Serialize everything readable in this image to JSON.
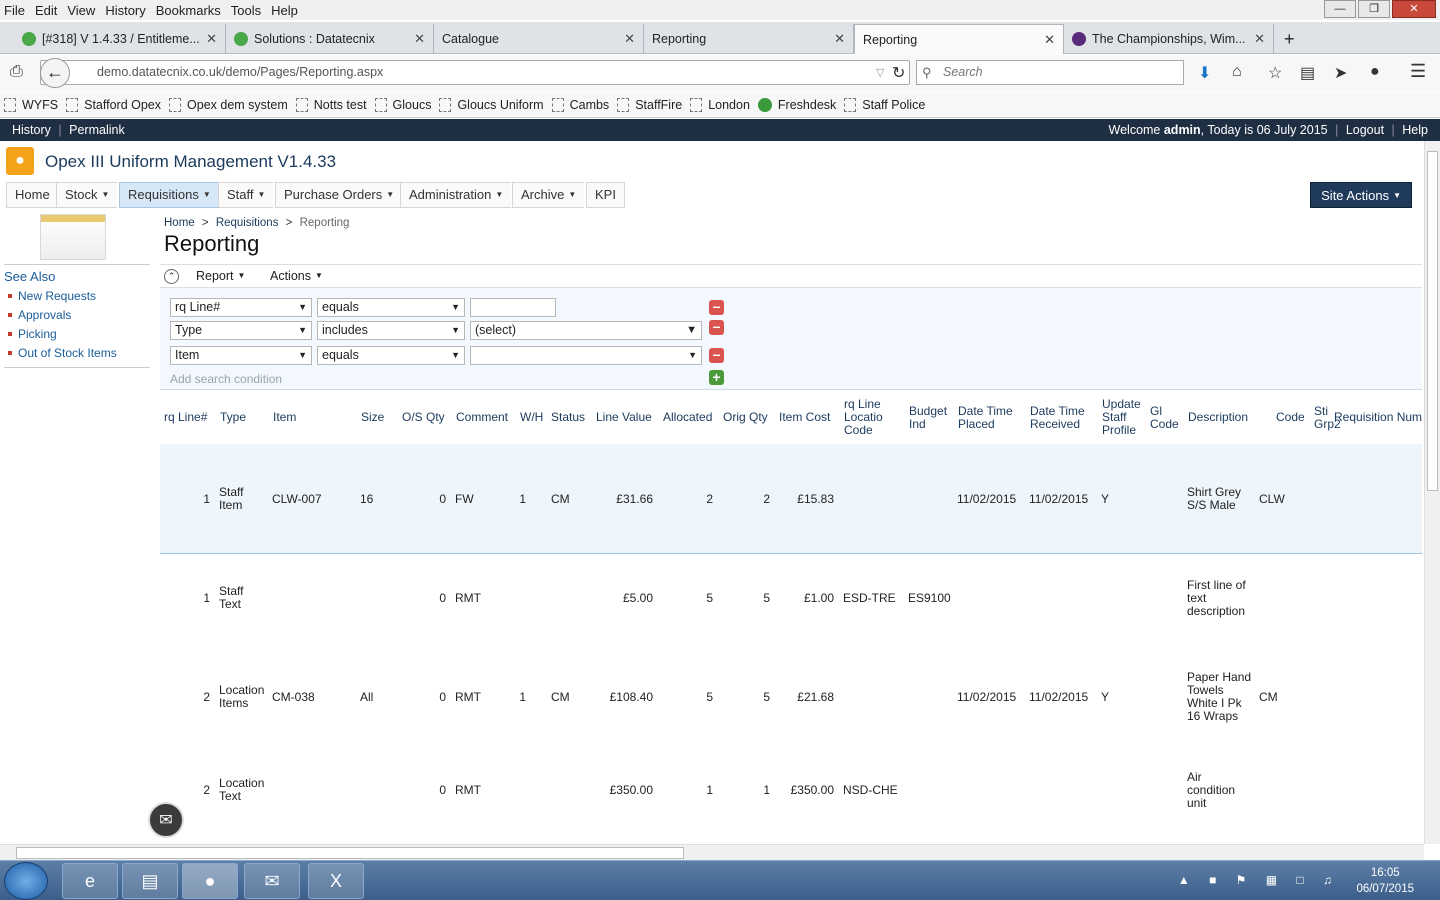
{
  "menubar": [
    "File",
    "Edit",
    "View",
    "History",
    "Bookmarks",
    "Tools",
    "Help"
  ],
  "tabs": [
    {
      "label": "[#318] V 1.4.33 / Entitleme...",
      "icon": "green"
    },
    {
      "label": "Solutions : Datatecnix",
      "icon": "green"
    },
    {
      "label": "Catalogue",
      "icon": ""
    },
    {
      "label": "Reporting",
      "icon": ""
    },
    {
      "label": "Reporting",
      "icon": ""
    },
    {
      "label": "The Championships, Wim...",
      "icon": "purple"
    }
  ],
  "nav": {
    "url": "demo.datatecnix.co.uk/demo/Pages/Reporting.aspx",
    "search_placeholder": "Search"
  },
  "bookmarks": [
    "WYFS",
    "Stafford Opex",
    "Opex dem system",
    "Notts test",
    "Gloucs",
    "Gloucs Uniform",
    "Cambs",
    "StaffFire",
    "London",
    "Freshdesk",
    "Staff Police"
  ],
  "sitetop": {
    "history": "History",
    "sep": "|",
    "permalink": "Permalink",
    "welcome_pre": "Welcome ",
    "user": "admin",
    "welcome_post": ", Today is 06 July 2015",
    "logout": "Logout",
    "help": "Help"
  },
  "app": {
    "title": "Opex III Uniform Management V1.4.33"
  },
  "topnav": [
    "Home",
    "Stock",
    "Requisitions",
    "Staff",
    "Purchase Orders",
    "Administration",
    "Archive",
    "KPI"
  ],
  "site_actions": "Site Actions",
  "sidebar": {
    "title": "See Also",
    "items": [
      "New Requests",
      "Approvals",
      "Picking",
      "Out of Stock Items"
    ]
  },
  "breadcrumb": {
    "home": "Home",
    "sep": ">",
    "requisitions": "Requisitions",
    "current": "Reporting"
  },
  "page_title": "Reporting",
  "toolbar": {
    "report": "Report",
    "actions": "Actions"
  },
  "filters": [
    {
      "field": "rq Line#",
      "op": "equals",
      "value": ""
    },
    {
      "field": "Type",
      "op": "includes",
      "value": "(select)"
    },
    {
      "field": "Item",
      "op": "equals",
      "value": ""
    }
  ],
  "add_condition": "Add search condition",
  "columns": [
    "rq Line#",
    "Type",
    "Item",
    "Size",
    "O/S Qty",
    "Comment",
    "W/H",
    "Status",
    "Line Value",
    "Allocated",
    "Orig Qty",
    "Item Cost",
    "rq Line Locatio Code",
    "Budget Ind",
    "Date Time Placed",
    "Date Time Received",
    "Update Staff Profile",
    "Gl Code",
    "Description",
    "Code",
    "Sti Grp2",
    "Requisition Num"
  ],
  "rows": [
    {
      "line": "1",
      "type": "Staff Item",
      "item": "CLW-007",
      "size": "16",
      "os": "0",
      "comment": "FW",
      "wh": "1",
      "status": "CM",
      "value": "£31.66",
      "alloc": "2",
      "orig": "2",
      "cost": "£15.83",
      "loc": "",
      "budget": "",
      "placed": "11/02/2015",
      "received": "11/02/2015",
      "upd": "Y",
      "gl": "",
      "desc": "Shirt Grey S/S Male",
      "code": "CLW"
    },
    {
      "line": "1",
      "type": "Staff Text",
      "item": "",
      "size": "",
      "os": "0",
      "comment": "RMT",
      "wh": "",
      "status": "",
      "value": "£5.00",
      "alloc": "5",
      "orig": "5",
      "cost": "£1.00",
      "loc": "ESD-TRE",
      "budget": "ES9100",
      "placed": "",
      "received": "",
      "upd": "",
      "gl": "",
      "desc": "First line of text description",
      "code": ""
    },
    {
      "line": "2",
      "type": "Location Items",
      "item": "CM-038",
      "size": "All",
      "os": "0",
      "comment": "RMT",
      "wh": "1",
      "status": "CM",
      "value": "£108.40",
      "alloc": "5",
      "orig": "5",
      "cost": "£21.68",
      "loc": "",
      "budget": "",
      "placed": "11/02/2015",
      "received": "11/02/2015",
      "upd": "Y",
      "gl": "",
      "desc": "Paper Hand Towels White I Pk 16 Wraps",
      "code": "CM"
    },
    {
      "line": "2",
      "type": "Location Text",
      "item": "",
      "size": "",
      "os": "0",
      "comment": "RMT",
      "wh": "",
      "status": "",
      "value": "£350.00",
      "alloc": "1",
      "orig": "1",
      "cost": "£350.00",
      "loc": "NSD-CHE",
      "budget": "",
      "placed": "",
      "received": "",
      "upd": "",
      "gl": "",
      "desc": "Air condition unit",
      "code": ""
    }
  ],
  "clock": {
    "time": "16:05",
    "date": "06/07/2015"
  }
}
